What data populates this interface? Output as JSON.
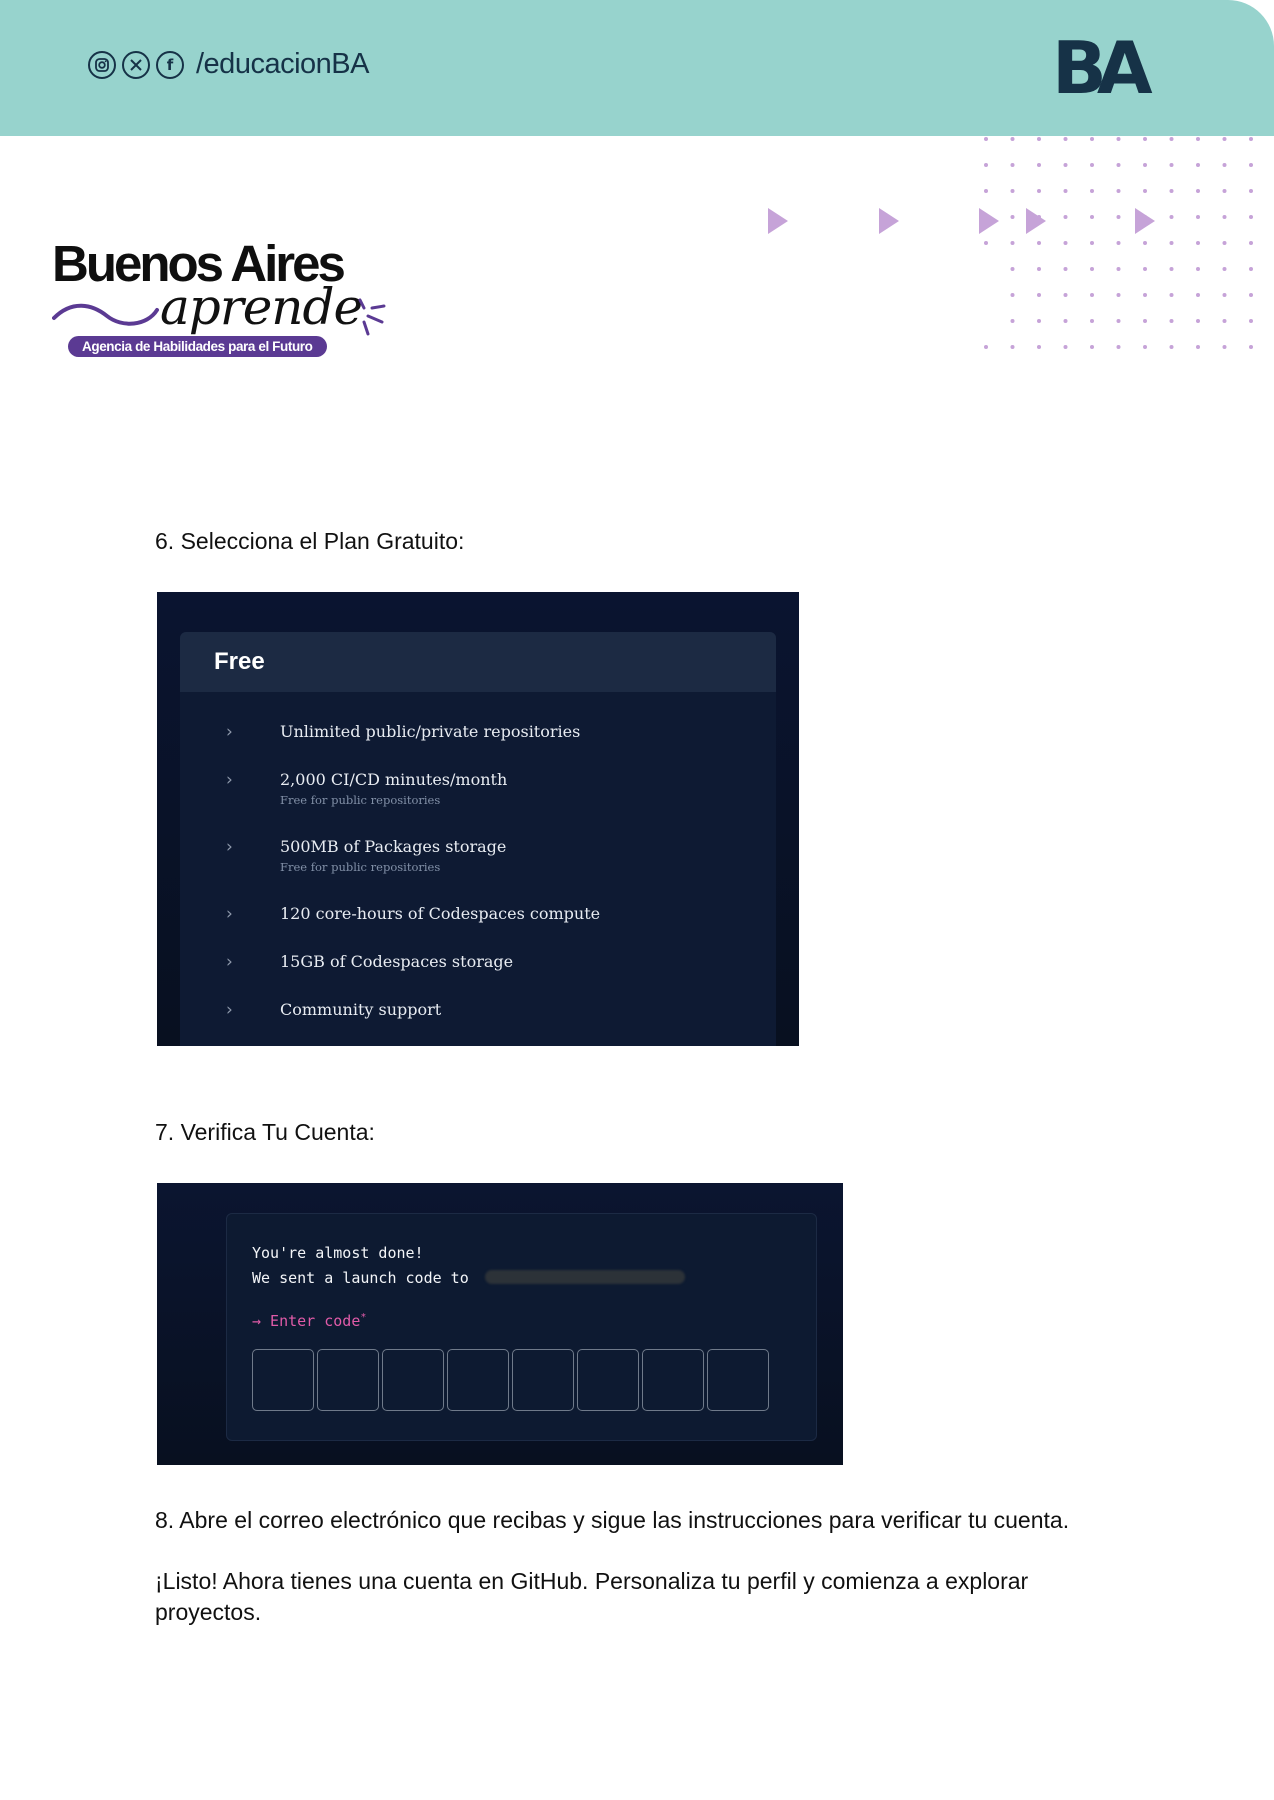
{
  "header": {
    "social_icons": [
      "instagram-icon",
      "x-icon",
      "facebook-icon"
    ],
    "handle": "/educacionBA",
    "ba_logo": "BA"
  },
  "brand": {
    "title": "Buenos Aires",
    "script": "aprende",
    "tagline": "Agencia de Habilidades para el Futuro"
  },
  "steps": {
    "step6": "6. Selecciona el Plan Gratuito:",
    "step7": "7. Verifica Tu Cuenta:",
    "step8": "8. Abre el correo electrónico que recibas y sigue las instrucciones para verificar tu cuenta.",
    "closing": "¡Listo! Ahora tienes una cuenta en GitHub. Personaliza tu perfil y comienza a explorar proyectos."
  },
  "plan_screenshot": {
    "title": "Free",
    "features": [
      {
        "title": "Unlimited public/private repositories",
        "sub": ""
      },
      {
        "title": "2,000 CI/CD minutes/month",
        "sub": "Free for public repositories"
      },
      {
        "title": "500MB of Packages storage",
        "sub": "Free for public repositories"
      },
      {
        "title": "120 core-hours of Codespaces compute",
        "sub": ""
      },
      {
        "title": "15GB of Codespaces storage",
        "sub": ""
      },
      {
        "title": "Community support",
        "sub": ""
      }
    ],
    "chevron": "›"
  },
  "verify_screenshot": {
    "line1": "You're almost done!",
    "line2": "We sent a launch code to",
    "prompt": "→ Enter code",
    "required_mark": "*",
    "code_boxes": 8
  },
  "colors": {
    "header_band": "#97d3cd",
    "navy": "#163247",
    "purple_accent": "#5b3a93",
    "lilac": "#c6a3d8",
    "pink_prompt": "#e05ba8"
  }
}
